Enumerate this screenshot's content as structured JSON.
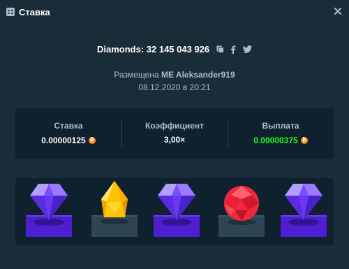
{
  "header": {
    "title": "Ставка"
  },
  "bet": {
    "diamonds_label": "Diamonds: 32 145 043 926",
    "placed_prefix": "Размещена",
    "placed_user": "ME Aleksander919",
    "date": "08.12.2020 в 20:21"
  },
  "stats": {
    "bet_label": "Ставка",
    "bet_value": "0.00000125",
    "multiplier_label": "Коэффициент",
    "multiplier_value": "3,00×",
    "payout_label": "Выплата",
    "payout_value": "0.00000375"
  },
  "currency": {
    "symbol": "₿",
    "color": "#f7931a"
  },
  "colors": {
    "background": "#1a2c38",
    "panel": "#0f212e",
    "muted_text": "#b1bad3",
    "payout_green": "#1fff20",
    "purple_pedestal": "#4d1fd1",
    "neutral_pedestal": "#2f4553"
  },
  "gems": [
    {
      "name": "purple-diamond",
      "color": "purple",
      "matched": true
    },
    {
      "name": "yellow-gem",
      "color": "yellow",
      "matched": false
    },
    {
      "name": "purple-diamond",
      "color": "purple",
      "matched": true
    },
    {
      "name": "red-gem",
      "color": "red",
      "matched": false
    },
    {
      "name": "purple-diamond",
      "color": "purple",
      "matched": true
    }
  ],
  "icons": [
    "bet-slip-icon",
    "close-icon",
    "copy-icon",
    "facebook-icon",
    "twitter-icon",
    "bitcoin-icon"
  ]
}
